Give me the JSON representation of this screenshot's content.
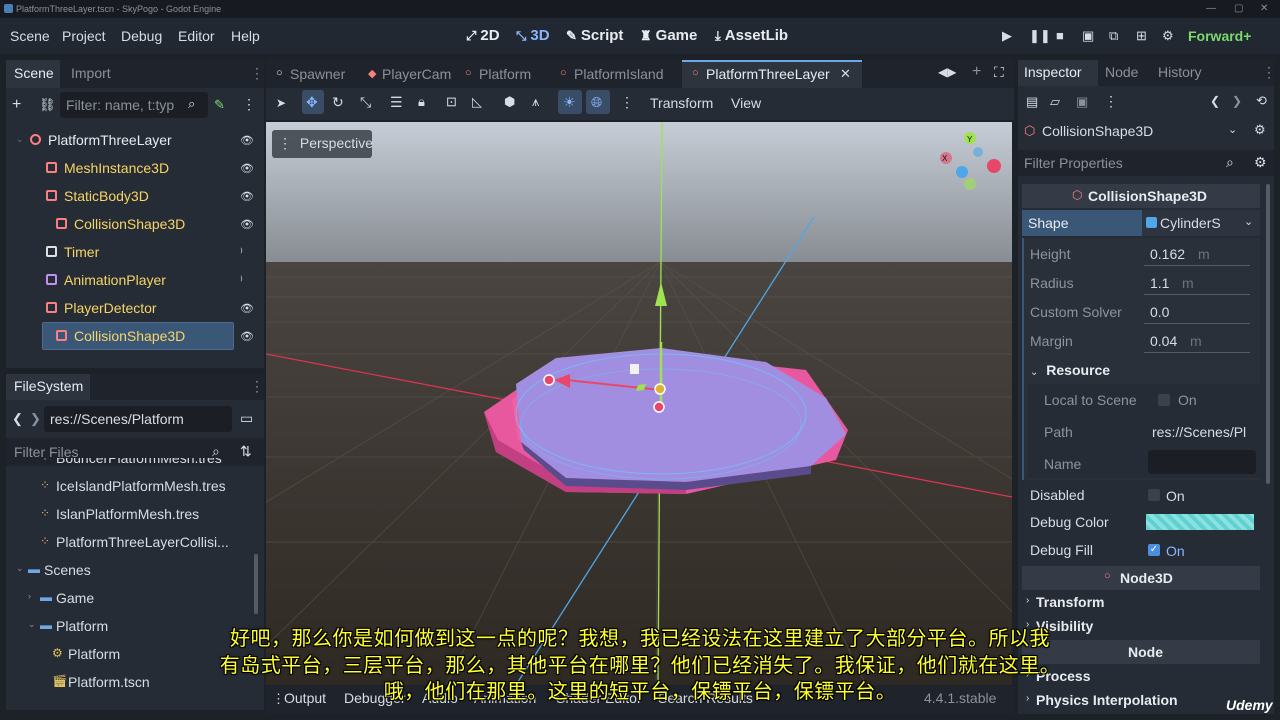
{
  "window_title": "PlatformThreeLayer.tscn - SkyPogo - Godot Engine",
  "menu": [
    "Scene",
    "Project",
    "Debug",
    "Editor",
    "Help"
  ],
  "workspaces": [
    {
      "label": "2D",
      "icon": "⤢"
    },
    {
      "label": "3D",
      "icon": "⤡"
    },
    {
      "label": "Script",
      "icon": "✎"
    },
    {
      "label": "Game",
      "icon": "♜"
    },
    {
      "label": "AssetLib",
      "icon": "⤓"
    }
  ],
  "renderer": "Forward+",
  "scene_dock": {
    "tabs": [
      "Scene",
      "Import"
    ],
    "filter_placeholder": "Filter: name, t:typ",
    "tree": [
      {
        "label": "PlatformThreeLayer",
        "indent": 0,
        "color": "#e8ecf1",
        "icon": "node3d-icon",
        "icon_color": "#fc7f7f"
      },
      {
        "label": "MeshInstance3D",
        "indent": 1,
        "color": "#f6d465",
        "icon": "mesh-icon",
        "icon_color": "#fc7f7f"
      },
      {
        "label": "StaticBody3D",
        "indent": 1,
        "color": "#f6d465",
        "icon": "staticbody-icon",
        "icon_color": "#fc7f7f"
      },
      {
        "label": "CollisionShape3D",
        "indent": 2,
        "color": "#f6d465",
        "icon": "collision-icon",
        "icon_color": "#fc7f7f"
      },
      {
        "label": "Timer",
        "indent": 1,
        "color": "#f6d465",
        "icon": "timer-icon",
        "icon_color": "#e0e0e0"
      },
      {
        "label": "AnimationPlayer",
        "indent": 1,
        "color": "#f6d465",
        "icon": "animation-icon",
        "icon_color": "#c38ef1"
      },
      {
        "label": "PlayerDetector",
        "indent": 1,
        "color": "#f6d465",
        "icon": "area-icon",
        "icon_color": "#fc7f7f"
      },
      {
        "label": "CollisionShape3D",
        "indent": 2,
        "color": "#f6d465",
        "icon": "collision-icon",
        "icon_color": "#fc7f7f",
        "selected": true
      }
    ]
  },
  "filesystem": {
    "tab": "FileSystem",
    "path": "res://Scenes/Platform",
    "filter_placeholder": "Filter Files",
    "items": [
      {
        "label": "BouncerPlatformMesh.tres",
        "indent": 2,
        "icon": "resource-icon"
      },
      {
        "label": "IceIslandPlatformMesh.tres",
        "indent": 2,
        "icon": "resource-icon"
      },
      {
        "label": "IslanPlatformMesh.tres",
        "indent": 2,
        "icon": "resource-icon"
      },
      {
        "label": "PlatformThreeLayerCollisi...",
        "indent": 2,
        "icon": "resource-icon"
      },
      {
        "label": "Scenes",
        "indent": 1,
        "icon": "folder-icon"
      },
      {
        "label": "Game",
        "indent": 2,
        "icon": "folder-icon"
      },
      {
        "label": "Platform",
        "indent": 2,
        "icon": "folder-icon"
      },
      {
        "label": "Platform",
        "indent": 3,
        "icon": "gear-icon"
      },
      {
        "label": "Platform.tscn",
        "indent": 3,
        "icon": "scene-icon"
      }
    ]
  },
  "editor_tabs": [
    {
      "label": "Spawner",
      "active": false
    },
    {
      "label": "PlayerCam",
      "active": false
    },
    {
      "label": "Platform",
      "active": false
    },
    {
      "label": "PlatformIsland",
      "active": false
    },
    {
      "label": "PlatformThreeLayer",
      "active": true
    }
  ],
  "viewport": {
    "menu": [
      "Transform",
      "View"
    ],
    "perspective_label": "Perspective"
  },
  "bottom_panel": {
    "tabs": [
      "Output",
      "Debugger",
      "Audio",
      "Animation",
      "Shader Editor",
      "Search Results"
    ],
    "version": "4.4.1.stable"
  },
  "inspector": {
    "tabs": [
      "Inspector",
      "Node",
      "History"
    ],
    "object": "CollisionShape3D",
    "filter_placeholder": "Filter Properties",
    "class_header": "CollisionShape3D",
    "shape_label": "Shape",
    "shape_value": "CylinderS",
    "props": [
      {
        "label": "Height",
        "value": "0.162",
        "unit": "m"
      },
      {
        "label": "Radius",
        "value": "1.1",
        "unit": "m"
      },
      {
        "label": "Custom Solver",
        "value": "0.0",
        "unit": ""
      },
      {
        "label": "Margin",
        "value": "0.04",
        "unit": "m"
      }
    ],
    "resource_section": "Resource",
    "local_to_scene_label": "Local to Scene",
    "local_to_scene_value": "On",
    "path_label": "Path",
    "path_value": "res://Scenes/Pl",
    "name_label": "Name",
    "disabled_label": "Disabled",
    "disabled_value": "On",
    "debug_color_label": "Debug Color",
    "debug_fill_label": "Debug Fill",
    "debug_fill_value": "On",
    "node3d_header": "Node3D",
    "sections": [
      "Transform",
      "Visibility",
      "Node",
      "Process",
      "Physics Interpolation"
    ]
  },
  "subtitles": [
    "好吧，那么你是如何做到这一点的呢？我想，我已经设法在这里建立了大部分平台。所以我",
    "有岛式平台，三层平台，那么，其他平台在哪里？他们已经消失了。我保证，他们就在这里。",
    "哦，他们在那里。这里的短平台，保镖平台，保镖平台。"
  ],
  "watermark": "Udemy"
}
